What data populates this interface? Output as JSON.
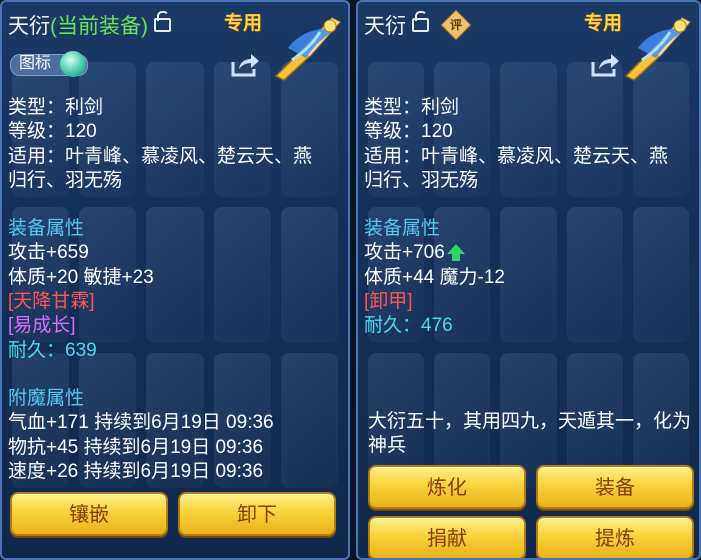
{
  "left": {
    "title": "天衍",
    "title_status": "(当前装备)",
    "exclusive": "专用",
    "icon_toggle_label": "图标",
    "type_line": "类型：利剑",
    "level_line": "等级：120",
    "applicable_line1": "适用：叶青峰、慕凌风、楚云天、燕",
    "applicable_line2": "归行、羽无殇",
    "attr_header": "装备属性",
    "attr_attack": "攻击+659",
    "attr_stats": "体质+20 敏捷+23",
    "special_skill": "[天降甘霖]",
    "special_effect": "[易成长]",
    "durability_label": "耐久：",
    "durability_value": "639",
    "enchant_header": "附魔属性",
    "enchant_hp": "气血+171 持续到6月19日 09:36",
    "enchant_pdef": "物抗+45 持续到6月19日 09:36",
    "enchant_speed": "速度+26 持续到6月19日 09:36",
    "buttons": {
      "inlay": "镶嵌",
      "unequip": "卸下"
    }
  },
  "right": {
    "title": "天衍",
    "rate_badge": "评",
    "exclusive": "专用",
    "type_line": "类型：利剑",
    "level_line": "等级：120",
    "applicable_line1": "适用：叶青峰、慕凌风、楚云天、燕",
    "applicable_line2": "归行、羽无殇",
    "attr_header": "装备属性",
    "attr_attack": "攻击+706",
    "attr_stats": "体质+44 魔力-12",
    "special_skill": "[卸甲]",
    "durability_label": "耐久：",
    "durability_value": "476",
    "description": "大衍五十，其用四九，天遁其一，化为神兵",
    "buttons": {
      "refine": "炼化",
      "equip": "装备",
      "donate": "捐献",
      "extract": "提炼"
    }
  },
  "colors": {
    "status_green": "#6be35b",
    "section_blue": "#55c8ee",
    "skill_red": "#ff5454",
    "effect_purple": "#d86cff",
    "durability_cyan": "#4fd9ee",
    "button_gold": "#f9d33a",
    "up_arrow_green": "#34d26a"
  },
  "icons": [
    "lock-icon",
    "weapon-sword-icon",
    "share-icon",
    "up-arrow-icon",
    "rate-badge-icon"
  ]
}
